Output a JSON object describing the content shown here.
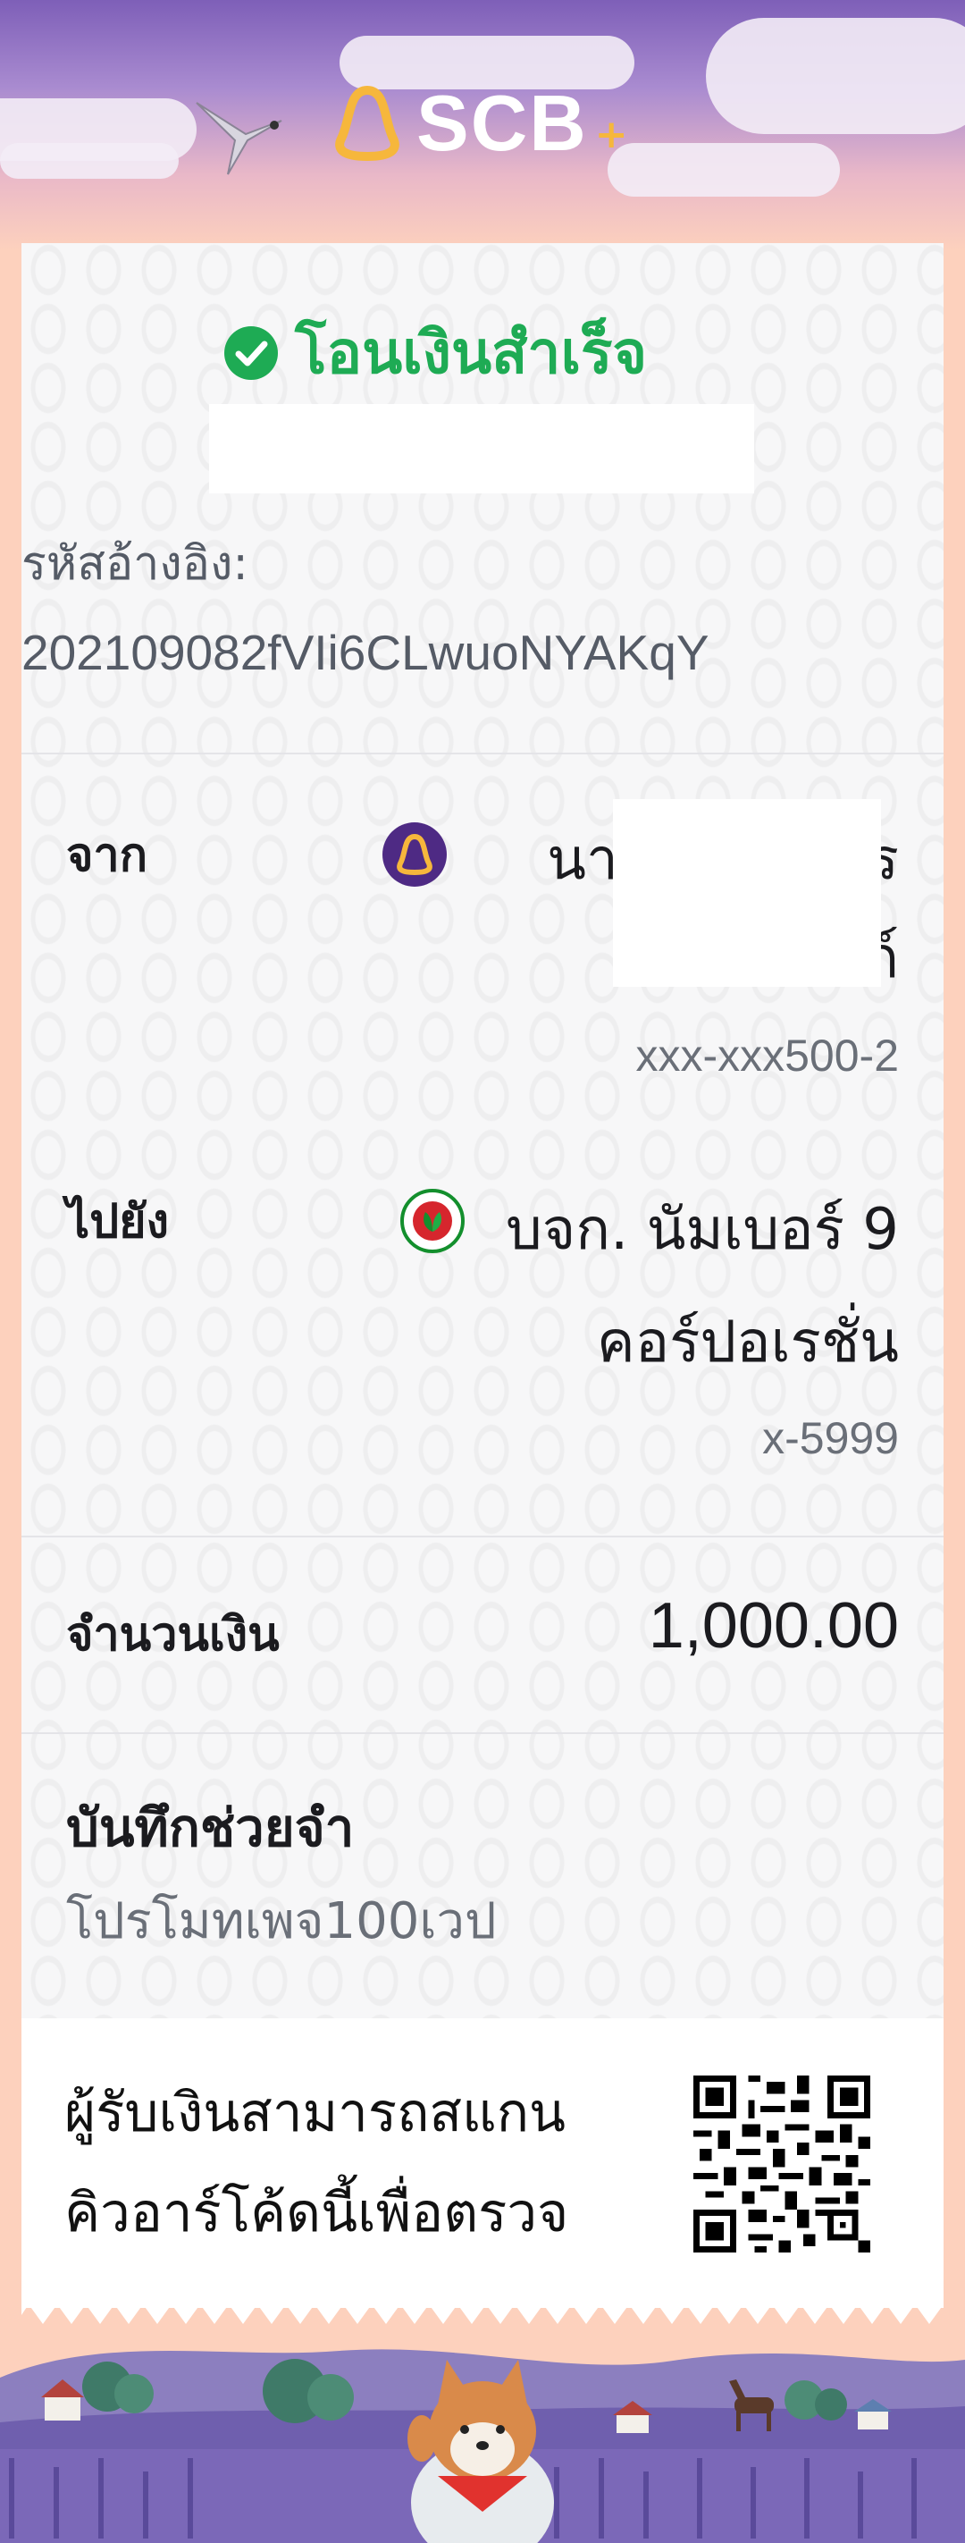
{
  "header": {
    "brand": "SCB",
    "brand_plus": "+"
  },
  "receipt": {
    "status_text": "โอนเงินสำเร็จ",
    "ref_label": "รหัสอ้างอิง:",
    "ref_value": "202109082fVIi6CLwuoNYAKqY",
    "from": {
      "label": "จาก",
      "name_line1": "นาย เ",
      "name_line2_end": "ร",
      "name_line3_end": "ก์",
      "account": "xxx-xxx500-2",
      "bank_icon": "scb-bank-icon"
    },
    "to": {
      "label": "ไปยัง",
      "name_line1": "บจก. นัมเบอร์ 9",
      "name_line2": "คอร์ปอเรชั่น",
      "account": "x-5999",
      "bank_icon": "kbank-bank-icon"
    },
    "amount_label": "จำนวนเงิน",
    "amount_value": "1,000.00",
    "memo_label": "บันทึกช่วยจำ",
    "memo_value": "โปรโมทเพจ100เวป",
    "notice_line1": "ผู้รับเงินสามารถสแกน",
    "notice_line2": "คิวอาร์โค้ดนี้เพื่อตรวจ"
  },
  "colors": {
    "success": "#1eab54",
    "scb_purple": "#4e2a84",
    "scb_gold": "#f6b73c",
    "kbank_green": "#138f2d"
  }
}
